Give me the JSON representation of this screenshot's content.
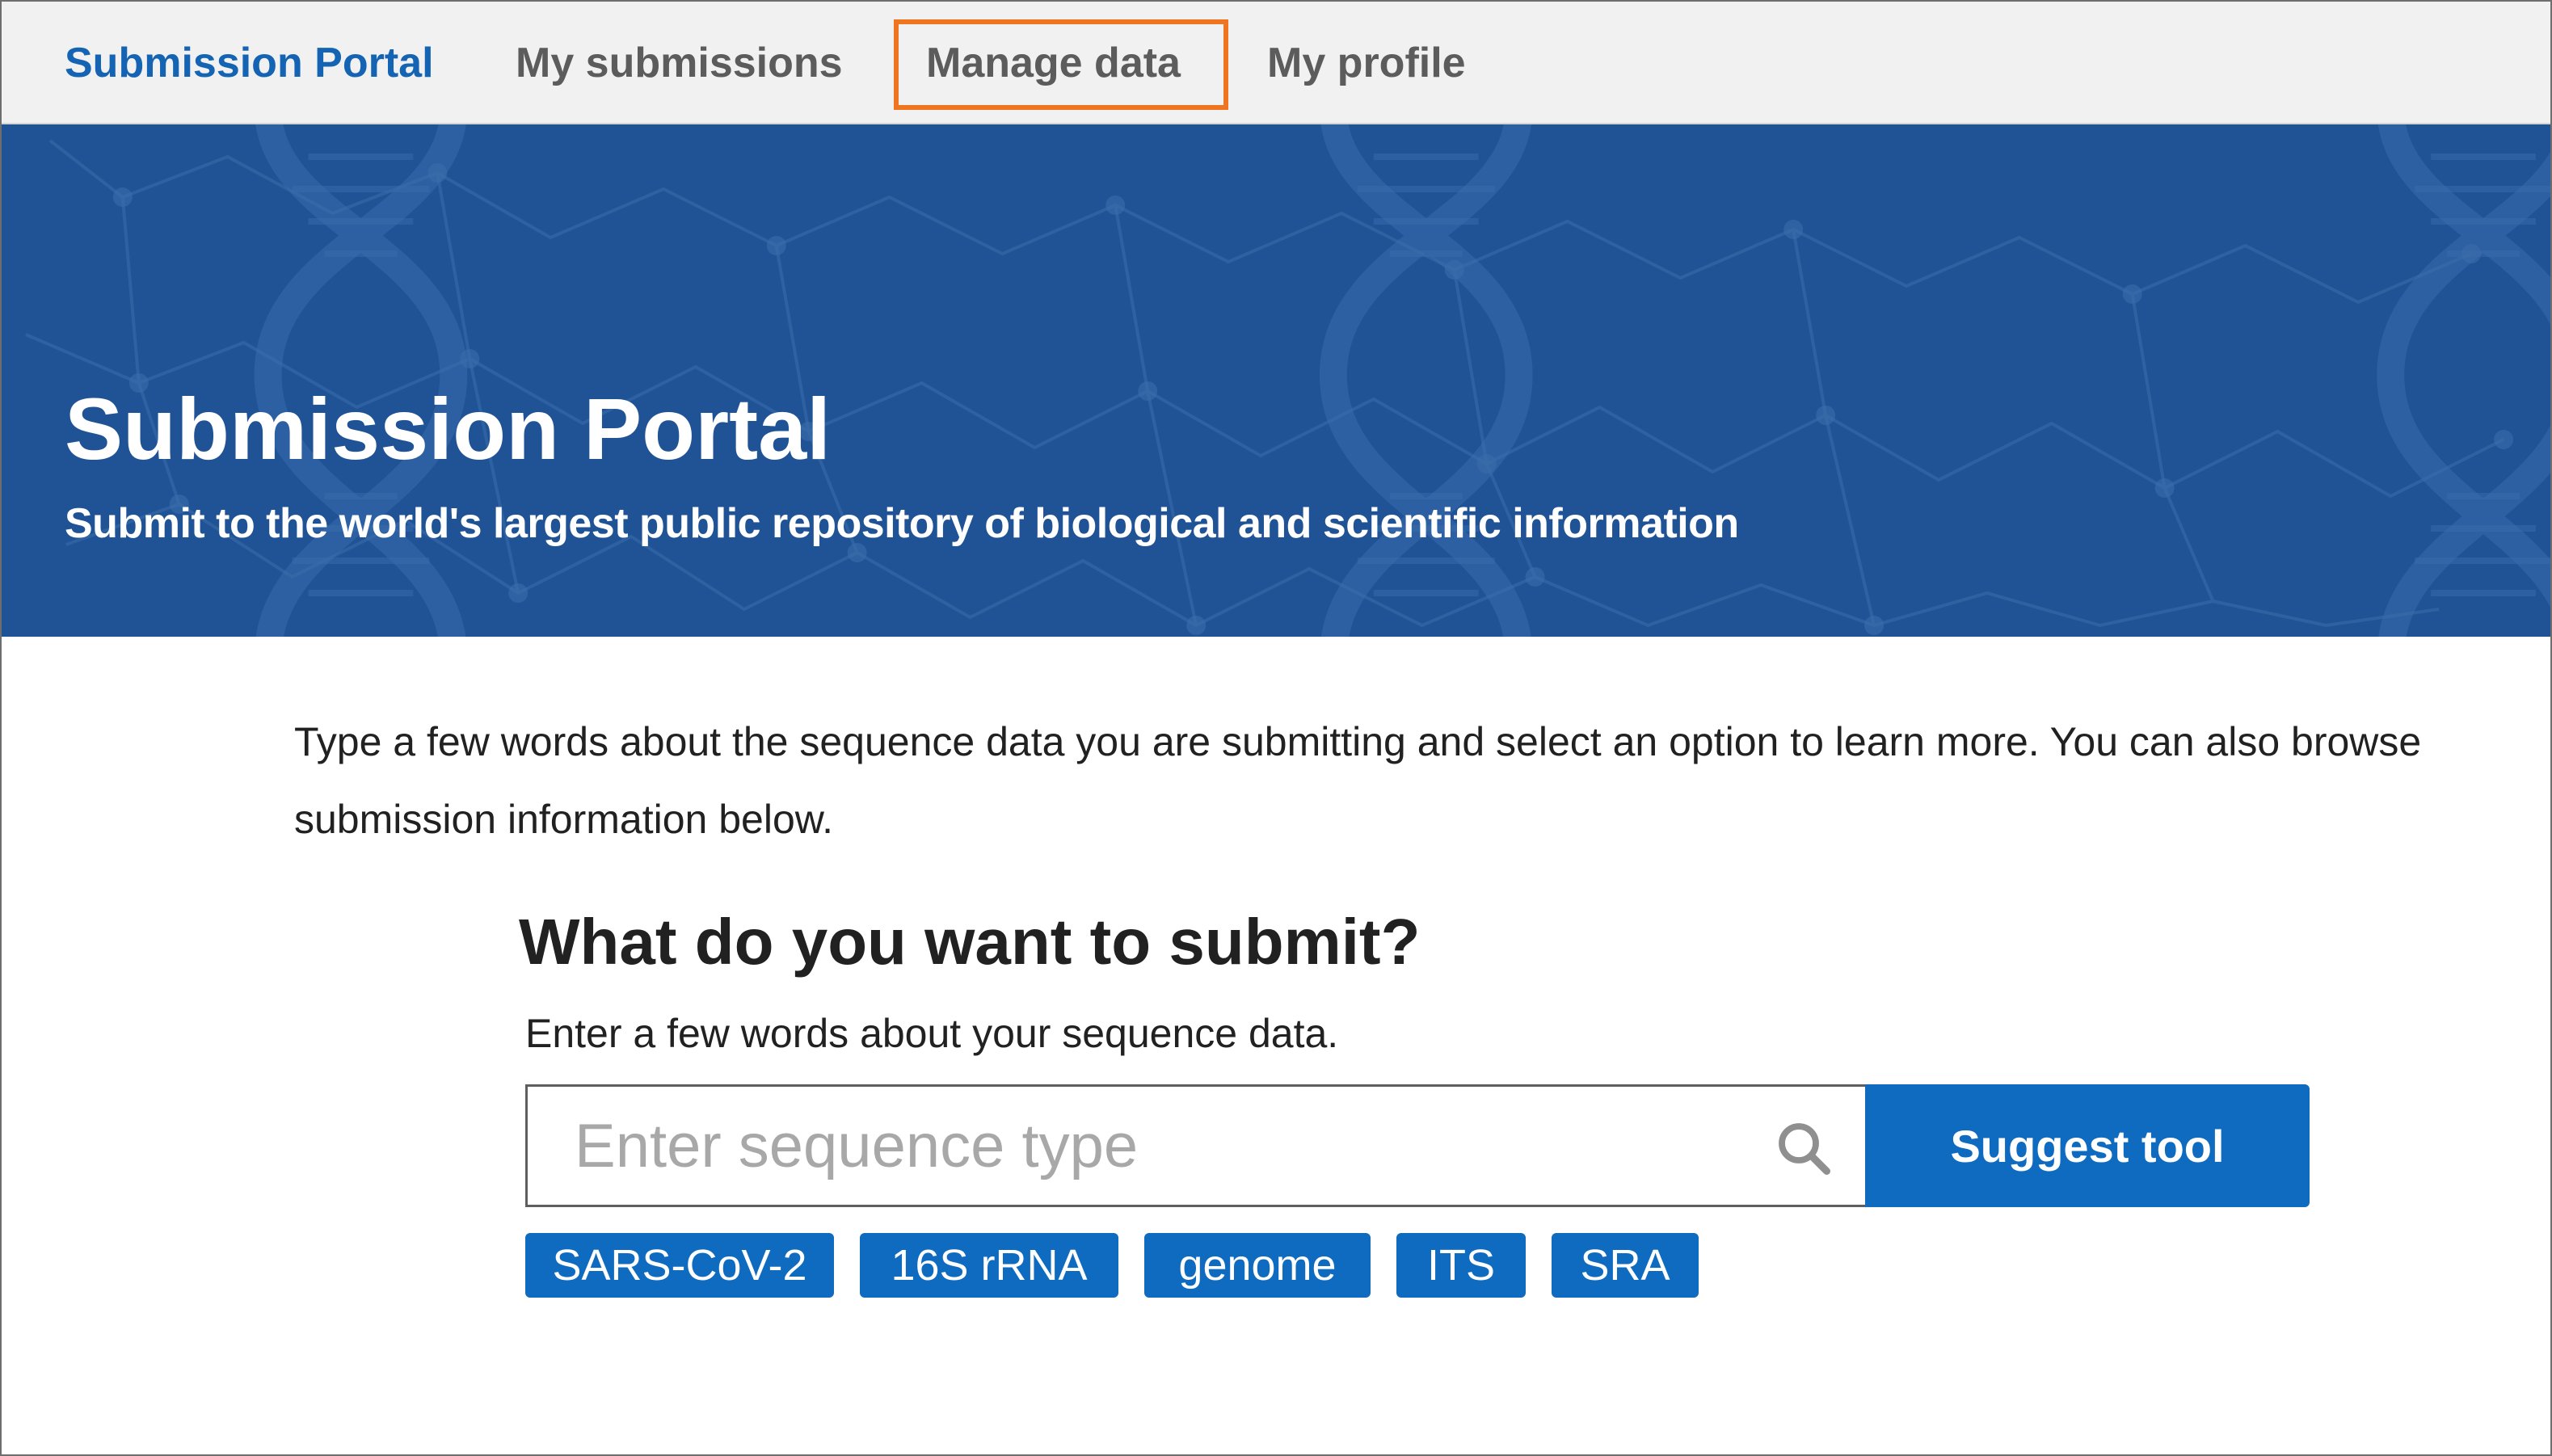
{
  "nav": {
    "brand": "Submission Portal",
    "items": [
      {
        "label": "My submissions"
      },
      {
        "label": "Manage data",
        "highlighted": true
      },
      {
        "label": "My profile"
      }
    ],
    "highlight_color": "#f0751f"
  },
  "hero": {
    "title": "Submission Portal",
    "subtitle": "Submit to the world's largest public repository of biological and scientific information",
    "background_color": "#1f5396"
  },
  "main": {
    "intro": "Type a few words about the sequence data you are submitting and select an option to learn more. You can also browse submission information below.",
    "heading": "What do you want to submit?",
    "helper": "Enter a few words about your sequence data.",
    "search": {
      "placeholder": "Enter sequence type",
      "value": "",
      "icon": "search-icon"
    },
    "suggest_button": "Suggest tool",
    "chips": [
      {
        "label": "SARS-CoV-2"
      },
      {
        "label": "16S rRNA"
      },
      {
        "label": "genome"
      },
      {
        "label": "ITS"
      },
      {
        "label": "SRA"
      }
    ]
  },
  "colors": {
    "brand_blue": "#1564b3",
    "button_blue": "#0f6bbf",
    "nav_background": "#f1f1f1"
  }
}
